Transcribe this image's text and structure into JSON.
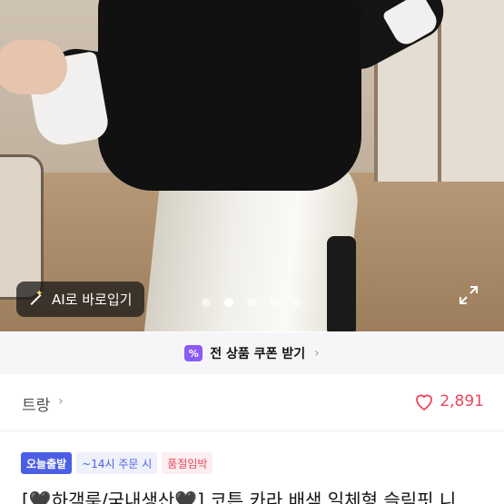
{
  "product_image": {
    "ai_button_label": "AI로 바로입기",
    "dots_count": 5,
    "active_dot": 2
  },
  "coupon": {
    "icon": "%",
    "label": "전 상품 쿠폰 받기",
    "chevron": "›"
  },
  "shop": {
    "name": "트랑",
    "chevron": "›",
    "likes": "2,891"
  },
  "badges": {
    "today": "오늘출발",
    "order_cutoff": "~14시 주문 시",
    "status": "품절임박"
  },
  "product": {
    "title": "[🖤하객룩/국내생산🖤] 코튼 카라 배색 일체형 슬림핏 니"
  },
  "colors": {
    "accent_purple": "#8b5cf6",
    "badge_blue": "#4b5fe6",
    "like_red": "#f0445e"
  }
}
